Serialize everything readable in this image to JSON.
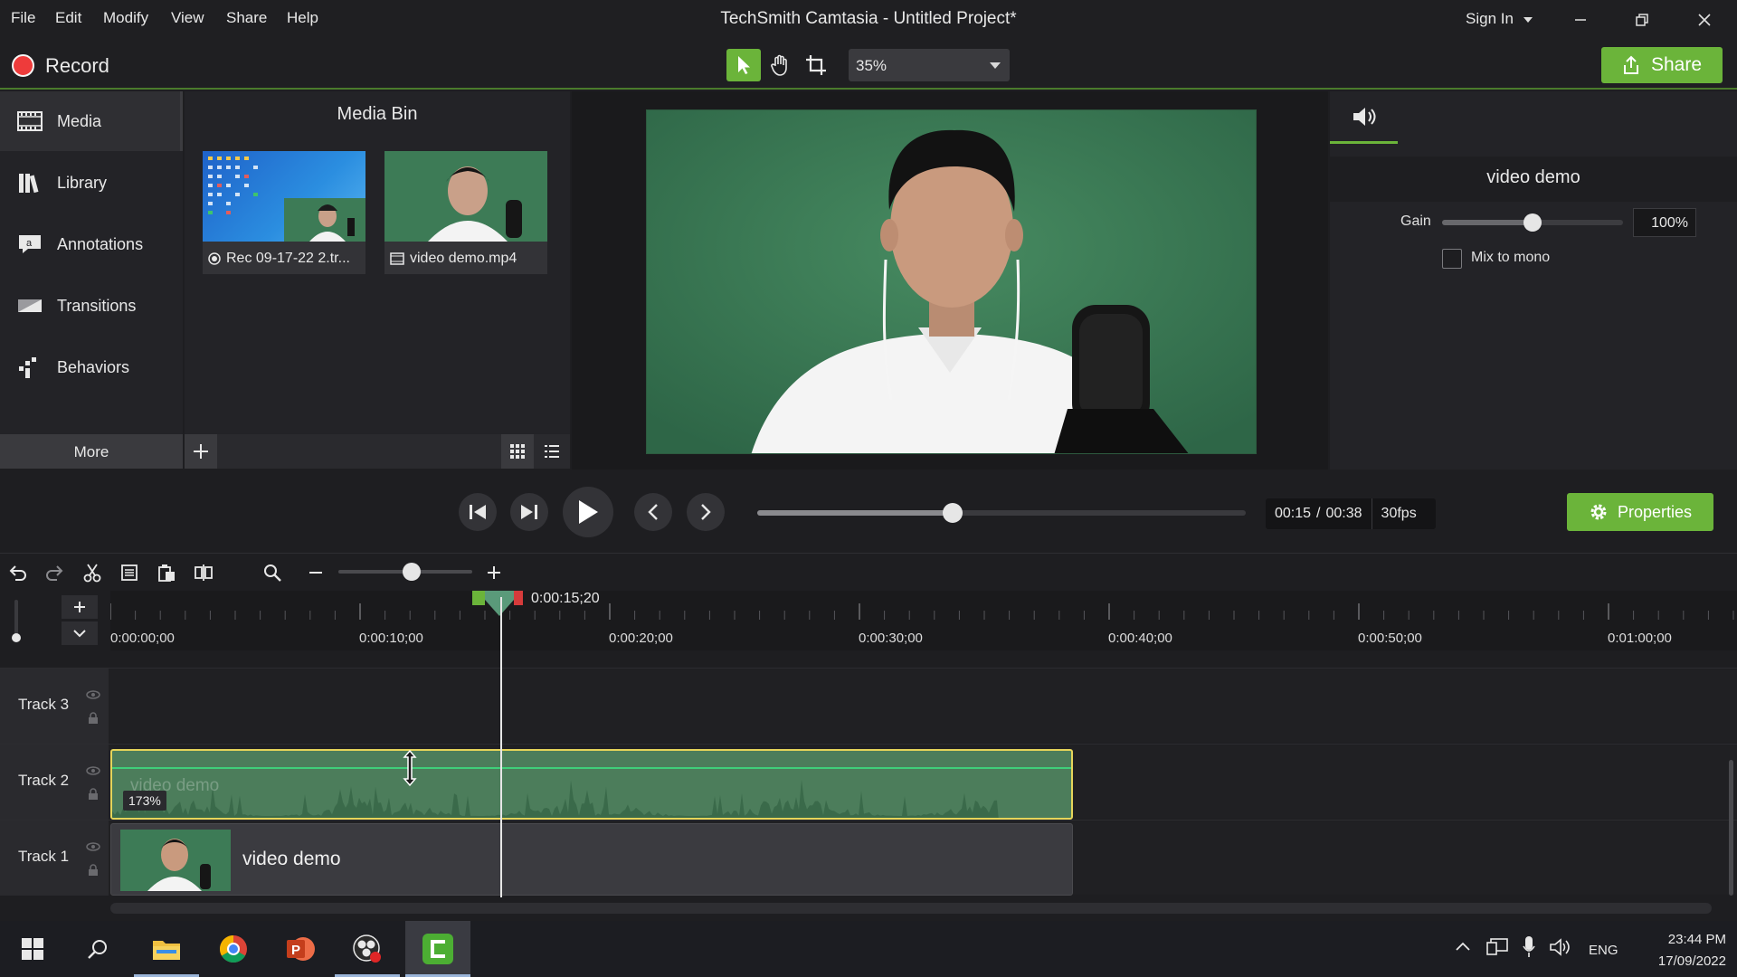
{
  "window": {
    "title": "TechSmith Camtasia - Untitled Project*",
    "menu": [
      "File",
      "Edit",
      "Modify",
      "View",
      "Share",
      "Help"
    ],
    "sign_in": "Sign In"
  },
  "toolbar": {
    "record_label": "Record",
    "zoom_value": "35%",
    "share_label": "Share"
  },
  "sidebar": {
    "items": [
      {
        "label": "Media",
        "icon": "film-icon"
      },
      {
        "label": "Library",
        "icon": "books-icon"
      },
      {
        "label": "Annotations",
        "icon": "annotation-icon"
      },
      {
        "label": "Transitions",
        "icon": "transition-icon"
      },
      {
        "label": "Behaviors",
        "icon": "behaviors-icon"
      }
    ],
    "more_label": "More"
  },
  "media_bin": {
    "title": "Media Bin",
    "items": [
      {
        "name": "Rec 09-17-22 2.tr...",
        "type_icon": "record-icon"
      },
      {
        "name": "video demo.mp4",
        "type_icon": "film-icon"
      }
    ]
  },
  "properties": {
    "clip_title": "video demo",
    "gain_label": "Gain",
    "gain_value": "100%",
    "gain_fraction": 0.5,
    "mix_to_mono_label": "Mix to mono",
    "mix_to_mono_checked": false,
    "button_label": "Properties"
  },
  "playback": {
    "current_time": "00:15",
    "separator": "/",
    "duration": "00:38",
    "fps": "30fps",
    "progress_fraction": 0.4
  },
  "timeline": {
    "playhead_time": "0:00:15;20",
    "zoom_fraction": 0.55,
    "ruler_labels": [
      "0:00:00;00",
      "0:00:10;00",
      "0:00:20;00",
      "0:00:30;00",
      "0:00:40;00",
      "0:00:50;00",
      "0:01:00;00"
    ],
    "tracks": [
      {
        "name": "Track 3"
      },
      {
        "name": "Track 2",
        "clip_title": "video demo",
        "clip_gain": "173%"
      },
      {
        "name": "Track 1",
        "clip_title": "video demo"
      }
    ]
  },
  "taskbar": {
    "language": "ENG",
    "time": "23:44 PM",
    "date": "17/09/2022"
  },
  "colors": {
    "accent_green": "#6bb43a",
    "record_red": "#ee3b3b",
    "audio_clip": "#4c7d5b",
    "selection_yellow": "#e5d45a"
  }
}
